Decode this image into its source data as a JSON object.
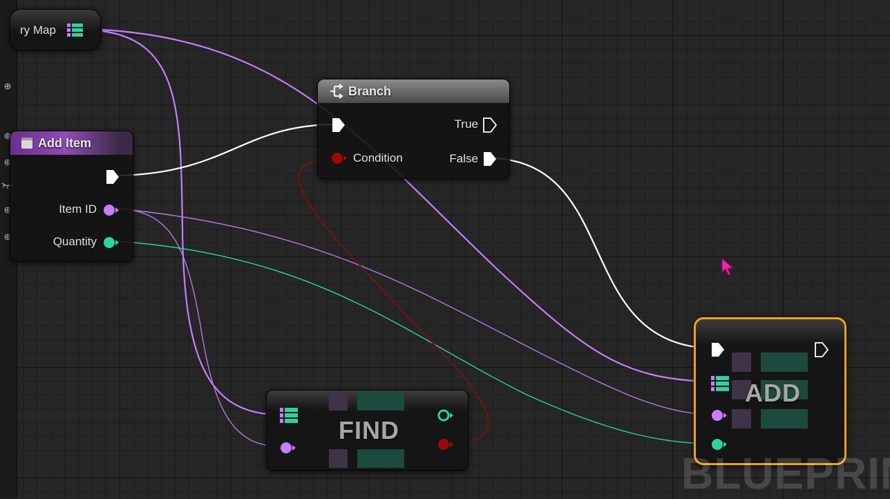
{
  "nodes": {
    "map_var": {
      "label": "ry Map"
    },
    "branch": {
      "title": "Branch",
      "exec_in": "",
      "condition": "Condition",
      "true_label": "True",
      "false_label": "False"
    },
    "add_item": {
      "title": "Add Item",
      "item_id": "Item ID",
      "quantity": "Quantity"
    },
    "find": {
      "label": "FIND"
    },
    "add": {
      "label": "ADD"
    }
  },
  "watermark": "BLUEPRIN",
  "colors": {
    "exec": "#ffffff",
    "map_pin": "#c77dff",
    "int_pin": "#c77dff",
    "float_pin": "#2ed3a2",
    "bool_pin": "#9b0a0a",
    "selection": "#f0a020",
    "cursor": "#ff1fae"
  },
  "icons": [
    "plus-circle-icon",
    "eye-closed-icon",
    "branch-icon",
    "function-icon",
    "map-icon",
    "cursor-icon"
  ]
}
